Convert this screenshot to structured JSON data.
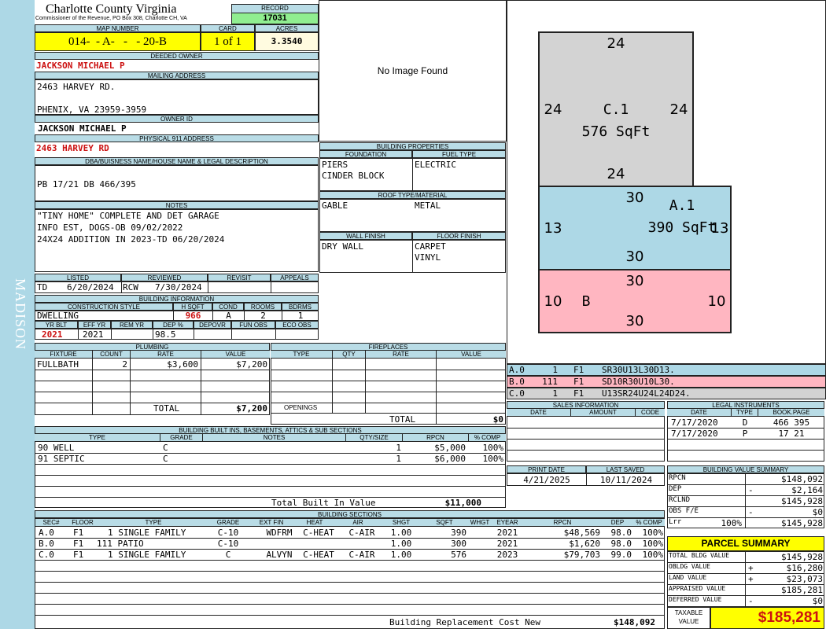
{
  "sidebar": {
    "district": "MADISON"
  },
  "header": {
    "county": "Charlotte County Virginia",
    "office": "Commissioner of the Revenue, PO Box 308, Charlotte CH, VA",
    "record_label": "RECORD",
    "record": "17031",
    "map_label": "MAP NUMBER",
    "map_number": "014-  - A-   -   - 20-B",
    "card_label": "CARD",
    "card": "1 of 1",
    "acres_label": "ACRES",
    "acres": "3.3540"
  },
  "owner": {
    "deeded_label": "DEEDED OWNER",
    "deeded_owner": "JACKSON MICHAEL P",
    "mailing_label": "MAILING ADDRESS",
    "mailing_line1": "2463 HARVEY RD.",
    "mailing_line2": "PHENIX, VA 23959-3959",
    "owner_id_label": "OWNER ID",
    "owner_id": "JACKSON MICHAEL P",
    "physical_label": "PHYSICAL 911 ADDRESS",
    "physical_address": "2463 HARVEY RD",
    "dba_label": "DBA/BUISNESS NAME/HOUSE NAME & LEGAL DESCRIPTION",
    "legal": "PB 17/21 DB 466/395"
  },
  "notes": {
    "label": "NOTES",
    "lines": [
      "\"TINY HOME\" COMPLETE AND DET GARAGE",
      "INFO EST, DOGS-OB 09/02/2022",
      "24X24 ADDITION IN 2023-TD 06/20/2024"
    ]
  },
  "image": {
    "placeholder": "No Image Found"
  },
  "properties": {
    "title": "BUILDING PROPERTIES",
    "foundation_label": "FOUNDATION",
    "foundation": [
      "PIERS",
      "CINDER BLOCK"
    ],
    "fuel_label": "FUEL TYPE",
    "fuel": "ELECTRIC",
    "roof_label": "ROOF TYPE/MATERIAL",
    "roof_type": "GABLE",
    "roof_material": "METAL",
    "wall_label": "WALL FINISH",
    "wall": "DRY WALL",
    "floor_label": "FLOOR FINISH",
    "floor": [
      "CARPET",
      "VINYL"
    ]
  },
  "review": {
    "listed_label": "LISTED",
    "listed_by": "TD",
    "listed_date": "6/20/2024",
    "reviewed_label": "REVIEWED",
    "reviewed_by": "RCW",
    "reviewed_date": "7/30/2024",
    "revisit_label": "REVISIT",
    "appeals_label": "APPEALS"
  },
  "building_info": {
    "title": "BUILDING INFORMATION",
    "labels": {
      "style": "CONSTRUCTION STYLE",
      "sqft": "H SQFT",
      "cond": "COND",
      "rooms": "ROOMS",
      "bdrms": "BDRMS",
      "yrblt": "YR BLT",
      "effyr": "EFF YR",
      "remyr": "REM YR",
      "dep": "DEP %",
      "depovr": "DEPOVR",
      "funobs": "FUN OBS",
      "ecoobs": "ECO OBS"
    },
    "style": "DWELLING",
    "sqft": "966",
    "cond": "A",
    "rooms": "2",
    "bdrms": "1",
    "yrblt": "2021",
    "effyr": "2021",
    "remyr": "",
    "dep": "98.5"
  },
  "plumbing": {
    "title": "PLUMBING",
    "headers": [
      "FIXTURE",
      "COUNT",
      "RATE",
      "VALUE"
    ],
    "rows": [
      {
        "fixture": "FULLBATH",
        "count": "2",
        "rate": "$3,600",
        "value": "$7,200"
      }
    ],
    "total_label": "TOTAL",
    "total": "$7,200"
  },
  "fireplaces": {
    "title": "FIREPLACES",
    "headers": [
      "TYPE",
      "QTY",
      "RATE",
      "VALUE"
    ],
    "openings_label": "OPENINGS",
    "total_label": "TOTAL",
    "total": "$0"
  },
  "sketch": {
    "sections": [
      {
        "name": "C.1",
        "area": "576 SqFt",
        "dims": [
          "24",
          "24",
          "24",
          "24"
        ]
      },
      {
        "name": "A.1",
        "area": "390 SqFt",
        "dims": [
          "30",
          "13",
          "30",
          "13"
        ]
      },
      {
        "name": "B",
        "area": "",
        "dims": [
          "30",
          "10",
          "30",
          "10"
        ]
      }
    ],
    "color_c": "#d3d3d3",
    "color_a": "#add8e6",
    "color_b": "#ffb6c1"
  },
  "sketch_legend": [
    {
      "code": "A.0",
      "count": "1",
      "floor": "F1",
      "path": "SR30U13L30D13."
    },
    {
      "code": "B.0",
      "count": "111",
      "floor": "F1",
      "path": "SD10R30U10L30."
    },
    {
      "code": "C.0",
      "count": "1",
      "floor": "F1",
      "path": "U13SR24U24L24D24."
    }
  ],
  "sales": {
    "title": "SALES INFORMATION",
    "headers": [
      "DATE",
      "AMOUNT",
      "CODE"
    ]
  },
  "legal_instruments": {
    "title": "LEGAL INSTRUMENTS",
    "headers": [
      "DATE",
      "TYPE",
      "BOOK.PAGE"
    ],
    "rows": [
      {
        "date": "7/17/2020",
        "type": "D",
        "book": "466 395"
      },
      {
        "date": "7/17/2020",
        "type": "P",
        "book": "17 21"
      }
    ]
  },
  "print": {
    "print_label": "PRINT DATE",
    "print_date": "4/21/2025",
    "saved_label": "LAST SAVED",
    "saved_date": "10/11/2024"
  },
  "built_ins": {
    "title": "BUILDING BUILT INS, BASEMENTS, ATTICS & SUB SECTIONS",
    "headers": [
      "TYPE",
      "GRADE",
      "NOTES",
      "QTY/SIZE",
      "RPCN",
      "% COMP"
    ],
    "rows": [
      {
        "type": "90 WELL",
        "grade": "C",
        "notes": "",
        "qty": "1",
        "rpcn": "$5,000",
        "comp": "100%"
      },
      {
        "type": "91 SEPTIC",
        "grade": "C",
        "notes": "",
        "qty": "1",
        "rpcn": "$6,000",
        "comp": "100%"
      }
    ],
    "total_label": "Total Built In Value",
    "total": "$11,000"
  },
  "value_summary": {
    "title": "BUILDING VALUE SUMMARY",
    "rows": [
      {
        "label": "RPCN",
        "pct": "",
        "sign": "",
        "value": "$148,092"
      },
      {
        "label": "DEP",
        "pct": "",
        "sign": "-",
        "value": "$2,164"
      },
      {
        "label": "RCLND",
        "pct": "",
        "sign": "",
        "value": "$145,928"
      },
      {
        "label": "OBS F/E",
        "pct": "",
        "sign": "-",
        "value": "$0"
      },
      {
        "label": "Lrr",
        "pct": "100%",
        "sign": "",
        "value": "$145,928"
      }
    ]
  },
  "sections": {
    "title": "BUILDING SECTIONS",
    "headers": [
      "SEC#",
      "FLOOR",
      "TYPE",
      "GRADE",
      "EXT FIN",
      "HEAT",
      "AIR",
      "SHGT",
      "SQFT",
      "WHGT",
      "EYEAR",
      "RPCN",
      "DEP",
      "% COMP"
    ],
    "rows": [
      [
        "A.0",
        "F1",
        "1 SINGLE FAMILY",
        "C-10",
        "WDFRM",
        "C-HEAT",
        "C-AIR",
        "1.00",
        "390",
        "",
        "2021",
        "$48,569",
        "98.0",
        "100%"
      ],
      [
        "B.0",
        "F1",
        "111 PATIO",
        "C-10",
        "",
        "",
        "",
        "1.00",
        "300",
        "",
        "2021",
        "$1,620",
        "98.0",
        "100%"
      ],
      [
        "C.0",
        "F1",
        "1 SINGLE FAMILY",
        "C",
        "ALVYN",
        "C-HEAT",
        "C-AIR",
        "1.00",
        "576",
        "",
        "2023",
        "$79,703",
        "99.0",
        "100%"
      ]
    ],
    "replacement_label": "Building Replacement Cost New",
    "replacement": "$148,092"
  },
  "parcel_summary": {
    "title": "PARCEL SUMMARY",
    "rows": [
      {
        "label": "TOTAL BLDG VALUE",
        "sign": "",
        "value": "$145,928"
      },
      {
        "label": "OBLDG VALUE",
        "sign": "+",
        "value": "$16,280"
      },
      {
        "label": "LAND VALUE",
        "sign": "+",
        "value": "$23,073"
      },
      {
        "label": "APPRAISED VALUE",
        "sign": "",
        "value": "$185,281"
      },
      {
        "label": "DEFERRED VALUE",
        "sign": "-",
        "value": "$0"
      }
    ],
    "taxable_label1": "TAXABLE",
    "taxable_label2": "VALUE",
    "taxable": "$185,281"
  }
}
